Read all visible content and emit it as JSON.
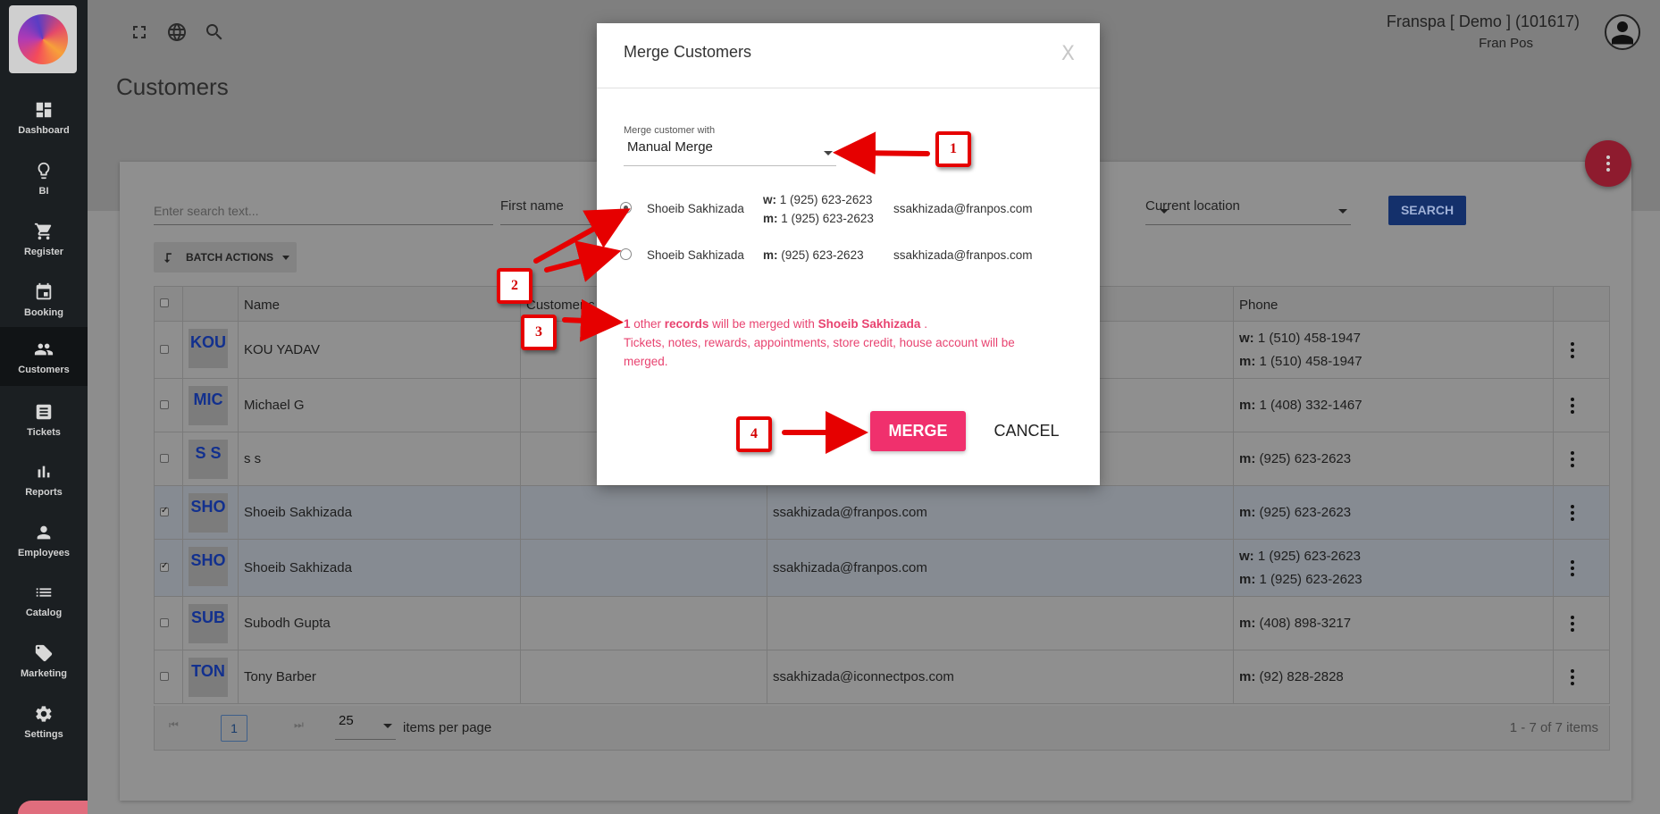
{
  "sidebar": {
    "items": [
      {
        "label": "Dashboard",
        "icon": "dashboard-icon"
      },
      {
        "label": "BI",
        "icon": "lightbulb-icon"
      },
      {
        "label": "Register",
        "icon": "cart-icon"
      },
      {
        "label": "Booking",
        "icon": "calendar-icon"
      },
      {
        "label": "Customers",
        "icon": "people-icon",
        "active": true
      },
      {
        "label": "Tickets",
        "icon": "ticket-icon"
      },
      {
        "label": "Reports",
        "icon": "bar-chart-icon"
      },
      {
        "label": "Employees",
        "icon": "person-icon"
      },
      {
        "label": "Catalog",
        "icon": "list-icon"
      },
      {
        "label": "Marketing",
        "icon": "tag-icon"
      },
      {
        "label": "Settings",
        "icon": "gear-icon"
      }
    ]
  },
  "header": {
    "page_title": "Customers",
    "account_name": "Franspa [ Demo ] (101617)",
    "account_sub": "Fran Pos"
  },
  "filters": {
    "search_placeholder": "Enter search text...",
    "first_name_label": "First name",
    "location_label": "Current location",
    "search_button": "SEARCH",
    "batch_actions": "BATCH ACTIONS"
  },
  "table": {
    "headers": {
      "name": "Name",
      "customer_code": "Customer c",
      "phone": "Phone"
    },
    "rows": [
      {
        "badge": "KOU",
        "name": "KOU YADAV",
        "email": "",
        "phones": [
          {
            "type": "w:",
            "number": "1 (510) 458-1947"
          },
          {
            "type": "m:",
            "number": "1 (510) 458-1947"
          }
        ],
        "checked": false
      },
      {
        "badge": "MIC",
        "name": "Michael G",
        "email": "",
        "phones": [
          {
            "type": "m:",
            "number": "1 (408) 332-1467"
          }
        ],
        "checked": false
      },
      {
        "badge": "S S",
        "name": "s s",
        "email": "",
        "phones": [
          {
            "type": "m:",
            "number": "(925) 623-2623"
          }
        ],
        "checked": false
      },
      {
        "badge": "SHO",
        "name": "Shoeib Sakhizada",
        "email": "ssakhizada@franpos.com",
        "phones": [
          {
            "type": "m:",
            "number": "(925) 623-2623"
          }
        ],
        "checked": true
      },
      {
        "badge": "SHO",
        "name": "Shoeib Sakhizada",
        "email": "ssakhizada@franpos.com",
        "phones": [
          {
            "type": "w:",
            "number": "1 (925) 623-2623"
          },
          {
            "type": "m:",
            "number": "1 (925) 623-2623"
          }
        ],
        "checked": true
      },
      {
        "badge": "SUB",
        "name": "Subodh Gupta",
        "email": "",
        "phones": [
          {
            "type": "m:",
            "number": "(408) 898-3217"
          }
        ],
        "checked": false
      },
      {
        "badge": "TON",
        "name": "Tony Barber",
        "email": "ssakhizada@iconnectpos.com",
        "phones": [
          {
            "type": "m:",
            "number": "(92) 828-2828"
          }
        ],
        "checked": false
      }
    ]
  },
  "pager": {
    "page": "1",
    "per_page": "25",
    "per_page_label": "items per page",
    "count": "1 - 7 of 7 items"
  },
  "modal": {
    "title": "Merge Customers",
    "close": "X",
    "merge_with_label": "Merge customer with",
    "merge_with_value": "Manual Merge",
    "candidates": [
      {
        "name": "Shoeib Sakhizada",
        "phones": [
          {
            "type": "w:",
            "number": "1 (925) 623-2623"
          },
          {
            "type": "m:",
            "number": "1 (925) 623-2623"
          }
        ],
        "email": "ssakhizada@franpos.com",
        "selected": true
      },
      {
        "name": "Shoeib Sakhizada",
        "phones": [
          {
            "type": "m:",
            "number": "(925) 623-2623"
          }
        ],
        "email": "ssakhizada@franpos.com",
        "selected": false
      }
    ],
    "note": {
      "count": "1",
      "other": " other ",
      "records": "records",
      "middle": " will be merged with ",
      "target": "Shoeib Sakhizada",
      "end": " .",
      "line2": "Tickets, notes, rewards, appointments, store credit, house account will be merged."
    },
    "merge_button": "MERGE",
    "cancel_button": "CANCEL"
  },
  "callouts": [
    "1",
    "2",
    "3",
    "4"
  ],
  "colors": {
    "sidebar_bg": "#1b1f22",
    "accent_pink": "#f0306d",
    "note_pink": "#e84370",
    "callout_red": "#e60000"
  }
}
